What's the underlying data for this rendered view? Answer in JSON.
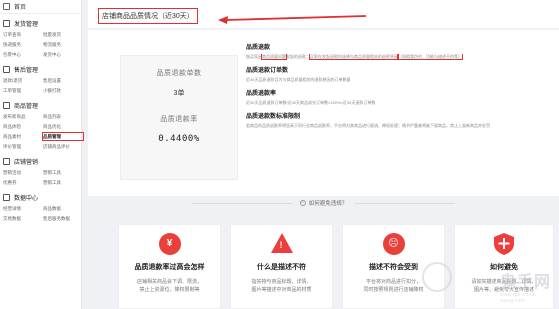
{
  "sidebar": {
    "home": "首页",
    "sections": [
      {
        "title": "发货管理",
        "items": [
          "订单查询",
          "批量发货",
          "快递服务",
          "物流服务",
          "包裹中心",
          "发货中心"
        ]
      },
      {
        "title": "售后管理",
        "items": [
          "退款/退货",
          "售后设置",
          "工单管理",
          "小额打款"
        ]
      },
      {
        "title": "商品管理",
        "items": [
          "发布新商品",
          "商品列表",
          "商品体检",
          "商品优化",
          "商品素材",
          "品质管理",
          "评价管理",
          "店铺商品评价"
        ]
      },
      {
        "title": "店铺营销",
        "items": [
          "营销活动",
          "营销工具",
          "优惠券",
          "营销工具"
        ]
      },
      {
        "title": "数据中心",
        "items": [
          "经营详情",
          "商品数据",
          "交易数据",
          "售后服务数据"
        ]
      }
    ],
    "active_item": "品质管理"
  },
  "header": {
    "title": "店铺商品品质情况（近30天）"
  },
  "metrics": {
    "refund_count_label": "品质退款单数",
    "refund_count_value": "3单",
    "refund_rate_label": "品质退款率",
    "refund_rate_value": "0.4400%"
  },
  "definitions": [
    {
      "title": "品质退款",
      "text_pre": "指买家因",
      "text_hl1": "商品质量问题",
      "text_mid": "发起的退款：",
      "text_hl2": "买家在发起退款时选择与商品质量相关的退款原因",
      "text_hl3": "（如假冒伪劣、功能与描述不符等）"
    },
    {
      "title": "品质退款订单数",
      "text": "近30天品质退款且为与商品质量相关的退款原因的订单数量"
    },
    {
      "title": "品质退款率",
      "text": "近30天品质退款订单数/近30天商品成交订单数×100%=近30天退款订单数"
    },
    {
      "title": "品质退款数标准限制",
      "text": "若商品的品质退款率明显高于同行业商品退款率，平台将对其商品进行限流、降权处理；情节严重者将被下架商品，禁止上架新商品并处罚"
    }
  ],
  "tip_title": "如何避免违规？",
  "cards": [
    {
      "icon_char": "¥",
      "title": "品质退款率过高会怎样",
      "lines": [
        "店铺相关商品会下调、限流，",
        "禁止上资源位，降权限制等"
      ]
    },
    {
      "icon_char": "!",
      "title": "什么是描述不符",
      "lines": [
        "指实物与商品标题、详情、",
        "图片等描述中对商品的材质"
      ]
    },
    {
      "icon_char": "☹",
      "title": "描述不符会受到",
      "lines": [
        "平台将对商品进行扣分，",
        "同时按照规则进行店铺降权"
      ]
    },
    {
      "icon_char": "✚",
      "title": "如何避免",
      "lines": [
        "请如实描述商品标题、详情、",
        "图片等，避免夸大宣传描述"
      ]
    }
  ],
  "watermark": {
    "brand": "鬼手网",
    "url": "www.gui-shou-wang.com"
  },
  "colors": {
    "accent": "#e03030",
    "icon_red": "#ea3f3a"
  }
}
